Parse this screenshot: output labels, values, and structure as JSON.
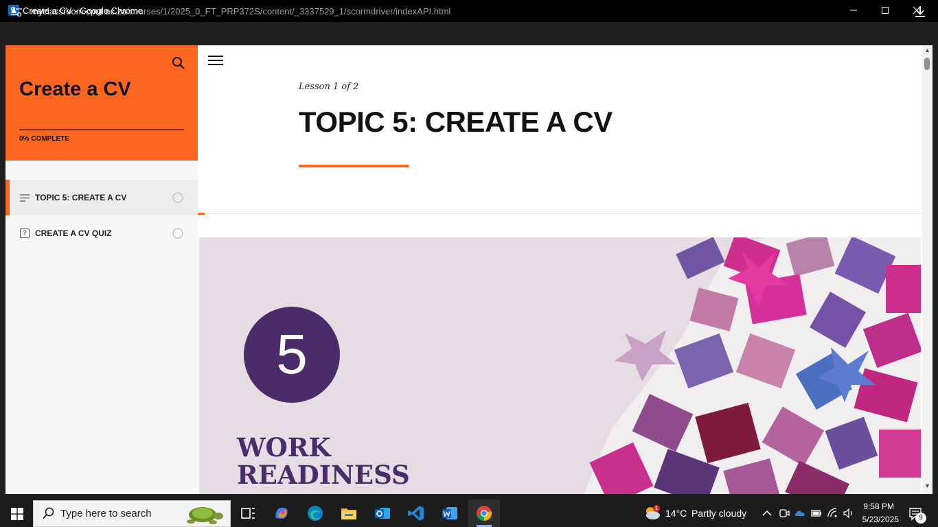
{
  "window": {
    "title": "Create a CV - Google Chrome",
    "controls": [
      "minimize",
      "maximize",
      "close"
    ]
  },
  "browser": {
    "url_host": "myclassroom.cput.ac.za",
    "url_path": "/courses/1/2025_0_FT_PRP372S/content/_3337529_1/scormdriver/indexAPI.html"
  },
  "sidebar": {
    "course_title": "Create a CV",
    "progress_text": "0% COMPLETE",
    "progress": 0,
    "items": [
      {
        "label": "TOPIC 5: CREATE A CV",
        "type": "lesson",
        "active": true
      },
      {
        "label": "CREATE A CV QUIZ",
        "type": "quiz",
        "active": false
      }
    ]
  },
  "lesson": {
    "count": "Lesson 1 of 2",
    "title": "TOPIC 5: CREATE A CV"
  },
  "banner": {
    "number": "5",
    "line1": "WORK",
    "line2": "READINESS"
  },
  "taskbar": {
    "search_placeholder": "Type here to search",
    "apps": [
      "task-view",
      "copilot",
      "edge",
      "file-explorer",
      "outlook",
      "vscode",
      "word",
      "chrome"
    ],
    "weather_temp": "14°C",
    "weather_condition": "Partly cloudy",
    "weather_badge": "1",
    "time": "9:58 PM",
    "date": "5/23/2025",
    "notification_count": "9"
  },
  "colors": {
    "accent": "#ff661f",
    "banner_purple": "#4a2c6b",
    "banner_bg": "#e6dce4"
  }
}
